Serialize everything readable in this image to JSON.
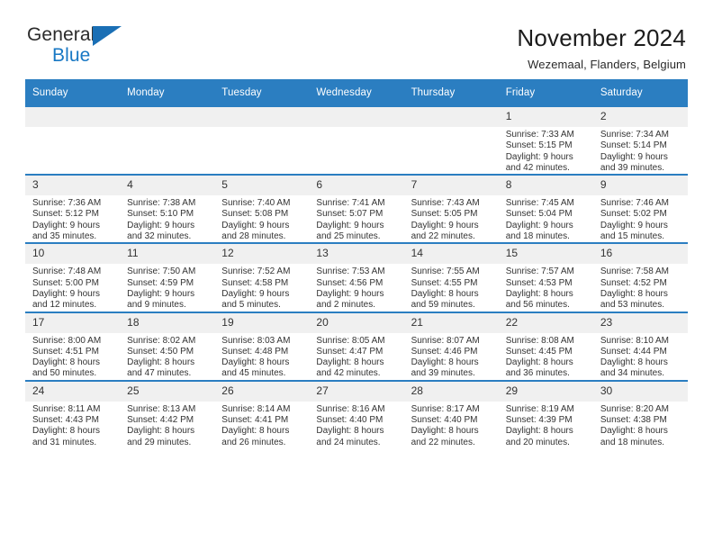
{
  "brand": {
    "name_top": "General",
    "name_bottom": "Blue",
    "accent_color": "#1878c4"
  },
  "header": {
    "title": "November 2024",
    "subtitle": "Wezemaal, Flanders, Belgium"
  },
  "theme": {
    "header_blue": "#2b7ec1",
    "daynum_bg": "#f0f0f0",
    "text": "#333333"
  },
  "weekday_headers": [
    "Sunday",
    "Monday",
    "Tuesday",
    "Wednesday",
    "Thursday",
    "Friday",
    "Saturday"
  ],
  "weeks": [
    [
      {
        "day": "",
        "blank": true,
        "sunrise": "",
        "sunset": "",
        "daylight1": "",
        "daylight2": ""
      },
      {
        "day": "",
        "blank": true,
        "sunrise": "",
        "sunset": "",
        "daylight1": "",
        "daylight2": ""
      },
      {
        "day": "",
        "blank": true,
        "sunrise": "",
        "sunset": "",
        "daylight1": "",
        "daylight2": ""
      },
      {
        "day": "",
        "blank": true,
        "sunrise": "",
        "sunset": "",
        "daylight1": "",
        "daylight2": ""
      },
      {
        "day": "",
        "blank": true,
        "sunrise": "",
        "sunset": "",
        "daylight1": "",
        "daylight2": ""
      },
      {
        "day": "1",
        "sunrise": "Sunrise: 7:33 AM",
        "sunset": "Sunset: 5:15 PM",
        "daylight1": "Daylight: 9 hours",
        "daylight2": "and 42 minutes."
      },
      {
        "day": "2",
        "sunrise": "Sunrise: 7:34 AM",
        "sunset": "Sunset: 5:14 PM",
        "daylight1": "Daylight: 9 hours",
        "daylight2": "and 39 minutes."
      }
    ],
    [
      {
        "day": "3",
        "sunrise": "Sunrise: 7:36 AM",
        "sunset": "Sunset: 5:12 PM",
        "daylight1": "Daylight: 9 hours",
        "daylight2": "and 35 minutes."
      },
      {
        "day": "4",
        "sunrise": "Sunrise: 7:38 AM",
        "sunset": "Sunset: 5:10 PM",
        "daylight1": "Daylight: 9 hours",
        "daylight2": "and 32 minutes."
      },
      {
        "day": "5",
        "sunrise": "Sunrise: 7:40 AM",
        "sunset": "Sunset: 5:08 PM",
        "daylight1": "Daylight: 9 hours",
        "daylight2": "and 28 minutes."
      },
      {
        "day": "6",
        "sunrise": "Sunrise: 7:41 AM",
        "sunset": "Sunset: 5:07 PM",
        "daylight1": "Daylight: 9 hours",
        "daylight2": "and 25 minutes."
      },
      {
        "day": "7",
        "sunrise": "Sunrise: 7:43 AM",
        "sunset": "Sunset: 5:05 PM",
        "daylight1": "Daylight: 9 hours",
        "daylight2": "and 22 minutes."
      },
      {
        "day": "8",
        "sunrise": "Sunrise: 7:45 AM",
        "sunset": "Sunset: 5:04 PM",
        "daylight1": "Daylight: 9 hours",
        "daylight2": "and 18 minutes."
      },
      {
        "day": "9",
        "sunrise": "Sunrise: 7:46 AM",
        "sunset": "Sunset: 5:02 PM",
        "daylight1": "Daylight: 9 hours",
        "daylight2": "and 15 minutes."
      }
    ],
    [
      {
        "day": "10",
        "sunrise": "Sunrise: 7:48 AM",
        "sunset": "Sunset: 5:00 PM",
        "daylight1": "Daylight: 9 hours",
        "daylight2": "and 12 minutes."
      },
      {
        "day": "11",
        "sunrise": "Sunrise: 7:50 AM",
        "sunset": "Sunset: 4:59 PM",
        "daylight1": "Daylight: 9 hours",
        "daylight2": "and 9 minutes."
      },
      {
        "day": "12",
        "sunrise": "Sunrise: 7:52 AM",
        "sunset": "Sunset: 4:58 PM",
        "daylight1": "Daylight: 9 hours",
        "daylight2": "and 5 minutes."
      },
      {
        "day": "13",
        "sunrise": "Sunrise: 7:53 AM",
        "sunset": "Sunset: 4:56 PM",
        "daylight1": "Daylight: 9 hours",
        "daylight2": "and 2 minutes."
      },
      {
        "day": "14",
        "sunrise": "Sunrise: 7:55 AM",
        "sunset": "Sunset: 4:55 PM",
        "daylight1": "Daylight: 8 hours",
        "daylight2": "and 59 minutes."
      },
      {
        "day": "15",
        "sunrise": "Sunrise: 7:57 AM",
        "sunset": "Sunset: 4:53 PM",
        "daylight1": "Daylight: 8 hours",
        "daylight2": "and 56 minutes."
      },
      {
        "day": "16",
        "sunrise": "Sunrise: 7:58 AM",
        "sunset": "Sunset: 4:52 PM",
        "daylight1": "Daylight: 8 hours",
        "daylight2": "and 53 minutes."
      }
    ],
    [
      {
        "day": "17",
        "sunrise": "Sunrise: 8:00 AM",
        "sunset": "Sunset: 4:51 PM",
        "daylight1": "Daylight: 8 hours",
        "daylight2": "and 50 minutes."
      },
      {
        "day": "18",
        "sunrise": "Sunrise: 8:02 AM",
        "sunset": "Sunset: 4:50 PM",
        "daylight1": "Daylight: 8 hours",
        "daylight2": "and 47 minutes."
      },
      {
        "day": "19",
        "sunrise": "Sunrise: 8:03 AM",
        "sunset": "Sunset: 4:48 PM",
        "daylight1": "Daylight: 8 hours",
        "daylight2": "and 45 minutes."
      },
      {
        "day": "20",
        "sunrise": "Sunrise: 8:05 AM",
        "sunset": "Sunset: 4:47 PM",
        "daylight1": "Daylight: 8 hours",
        "daylight2": "and 42 minutes."
      },
      {
        "day": "21",
        "sunrise": "Sunrise: 8:07 AM",
        "sunset": "Sunset: 4:46 PM",
        "daylight1": "Daylight: 8 hours",
        "daylight2": "and 39 minutes."
      },
      {
        "day": "22",
        "sunrise": "Sunrise: 8:08 AM",
        "sunset": "Sunset: 4:45 PM",
        "daylight1": "Daylight: 8 hours",
        "daylight2": "and 36 minutes."
      },
      {
        "day": "23",
        "sunrise": "Sunrise: 8:10 AM",
        "sunset": "Sunset: 4:44 PM",
        "daylight1": "Daylight: 8 hours",
        "daylight2": "and 34 minutes."
      }
    ],
    [
      {
        "day": "24",
        "sunrise": "Sunrise: 8:11 AM",
        "sunset": "Sunset: 4:43 PM",
        "daylight1": "Daylight: 8 hours",
        "daylight2": "and 31 minutes."
      },
      {
        "day": "25",
        "sunrise": "Sunrise: 8:13 AM",
        "sunset": "Sunset: 4:42 PM",
        "daylight1": "Daylight: 8 hours",
        "daylight2": "and 29 minutes."
      },
      {
        "day": "26",
        "sunrise": "Sunrise: 8:14 AM",
        "sunset": "Sunset: 4:41 PM",
        "daylight1": "Daylight: 8 hours",
        "daylight2": "and 26 minutes."
      },
      {
        "day": "27",
        "sunrise": "Sunrise: 8:16 AM",
        "sunset": "Sunset: 4:40 PM",
        "daylight1": "Daylight: 8 hours",
        "daylight2": "and 24 minutes."
      },
      {
        "day": "28",
        "sunrise": "Sunrise: 8:17 AM",
        "sunset": "Sunset: 4:40 PM",
        "daylight1": "Daylight: 8 hours",
        "daylight2": "and 22 minutes."
      },
      {
        "day": "29",
        "sunrise": "Sunrise: 8:19 AM",
        "sunset": "Sunset: 4:39 PM",
        "daylight1": "Daylight: 8 hours",
        "daylight2": "and 20 minutes."
      },
      {
        "day": "30",
        "sunrise": "Sunrise: 8:20 AM",
        "sunset": "Sunset: 4:38 PM",
        "daylight1": "Daylight: 8 hours",
        "daylight2": "and 18 minutes."
      }
    ]
  ]
}
